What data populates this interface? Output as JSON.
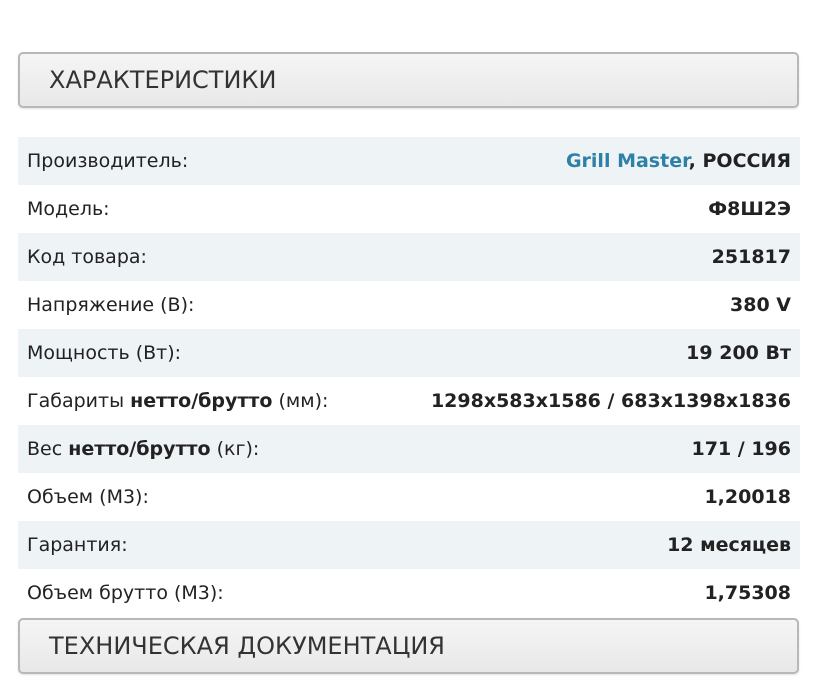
{
  "sections": {
    "specs_title": "ХАРАКТЕРИСТИКИ",
    "docs_title": "ТЕХНИЧЕСКАЯ ДОКУМЕНТАЦИЯ"
  },
  "specs": {
    "manufacturer": {
      "label": "Производитель:",
      "brand": "Grill Master",
      "separator": ", ",
      "country": "РОССИЯ"
    },
    "model": {
      "label": "Модель:",
      "value": "Ф8Ш2Э"
    },
    "sku": {
      "label": "Код товара:",
      "value": "251817"
    },
    "voltage": {
      "label": "Напряжение (В):",
      "value": "380 V"
    },
    "power": {
      "label": "Мощность (Вт):",
      "value": "19 200 Вт"
    },
    "dimensions": {
      "label_pre": "Габариты ",
      "label_bold": "нетто/брутто",
      "label_post": " (мм):",
      "value": "1298x583x1586 / 683x1398x1836"
    },
    "weight": {
      "label_pre": "Вес ",
      "label_bold": "нетто/брутто",
      "label_post": " (кг):",
      "value": "171 / 196"
    },
    "volume": {
      "label": "Объем (М3):",
      "value": "1,20018"
    },
    "warranty": {
      "label": "Гарантия:",
      "value": "12 месяцев"
    },
    "gross_volume": {
      "label": "Объем брутто (М3):",
      "value": "1,75308"
    }
  },
  "colors": {
    "brand_link": "#2f80a6",
    "row_shade": "#eef3f6",
    "header_border": "#b8b8b8"
  }
}
